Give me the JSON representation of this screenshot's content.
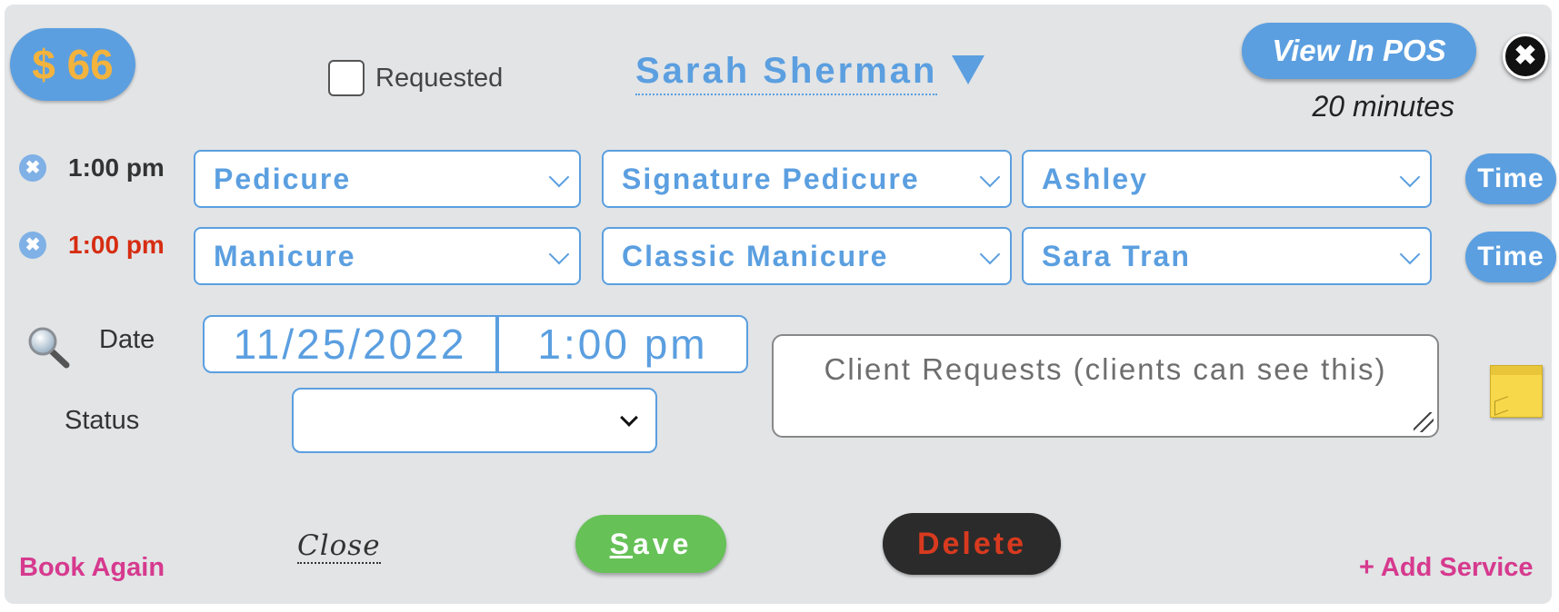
{
  "header": {
    "price": "$ 66",
    "requested_label": "Requested",
    "requested_checked": false,
    "client_name": "Sarah Sherman",
    "view_pos_label": "View In POS",
    "duration": "20 minutes"
  },
  "services": [
    {
      "time": "1:00 pm",
      "time_color": "#333333",
      "category": "Pedicure",
      "service": "Signature Pedicure",
      "staff": "Ashley",
      "time_button": "Time"
    },
    {
      "time": "1:00 pm",
      "time_color": "#d62d12",
      "category": "Manicure",
      "service": "Classic Manicure",
      "staff": "Sara Tran",
      "time_button": "Time"
    }
  ],
  "details": {
    "date_label": "Date",
    "date_value": "11/25/2022",
    "time_value": "1:00 pm",
    "status_label": "Status",
    "status_value": "",
    "notes_placeholder": "Client Requests (clients can see this)"
  },
  "footer": {
    "book_again": "Book Again",
    "close": "Close",
    "save_first": "S",
    "save_rest": "ave",
    "delete": "Delete",
    "add_service": "+ Add Service"
  },
  "colors": {
    "accent": "#5b9fe0",
    "price_text": "#f3b33d",
    "save_green": "#66c157",
    "delete_red": "#d83a1f",
    "link_pink": "#d63a8e",
    "panel_bg": "#e2e4e6"
  }
}
